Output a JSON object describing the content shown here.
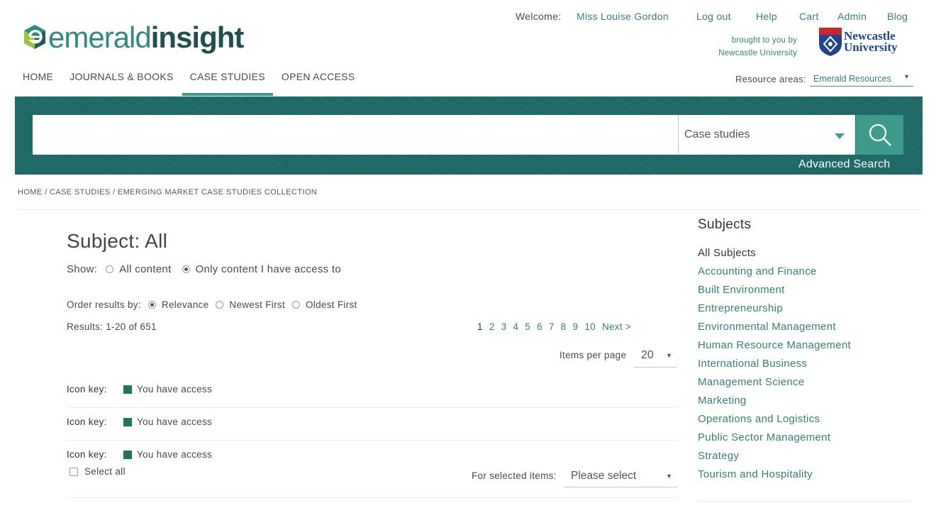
{
  "header": {
    "welcome_label": "Welcome:",
    "user_name": "Miss Louise Gordon",
    "links": [
      "Log out",
      "Help",
      "Cart",
      "Admin",
      "Blog"
    ],
    "logo": {
      "part1": "emerald",
      "part2": "insight"
    },
    "brought_by": [
      "brought to you by",
      "Newcastle University"
    ],
    "institution": [
      "Newcastle",
      "University"
    ],
    "resource_label": "Resource areas:",
    "resource_value": "Emerald Resources",
    "brand_color": "#1f6a66",
    "accent_color": "#3b9c8f"
  },
  "nav": {
    "items": [
      "HOME",
      "JOURNALS & BOOKS",
      "CASE STUDIES",
      "OPEN ACCESS"
    ],
    "active": "CASE STUDIES"
  },
  "search": {
    "query": "",
    "type": "Case studies",
    "advanced_label": "Advanced Search"
  },
  "breadcrumb": [
    "HOME",
    "CASE STUDIES",
    "EMERGING MARKET CASE STUDIES COLLECTION"
  ],
  "main": {
    "title": "Subject: All",
    "show_label": "Show:",
    "show_options": [
      "All content",
      "Only content I have access to"
    ],
    "show_selected": "Only content I have access to",
    "order_label": "Order results by:",
    "order_options": [
      "Relevance",
      "Newest First",
      "Oldest First"
    ],
    "order_selected": "Relevance",
    "results_text": "Results: 1-20 of 651",
    "pages": [
      "1",
      "2",
      "3",
      "4",
      "5",
      "6",
      "7",
      "8",
      "9",
      "10",
      "Next >"
    ],
    "current_page": "1",
    "items_per_page_label": "Items per page",
    "items_per_page": "20",
    "icon_key_rows": [
      {
        "label": "Icon key:",
        "value": "You have access"
      },
      {
        "label": "Icon key:",
        "value": "You have access"
      },
      {
        "label": "Icon key:",
        "value": "You have access"
      }
    ],
    "access_color": "#1f7a4a",
    "select_all_label": "Select all",
    "bulk_label": "For selected items:",
    "bulk_value": "Please select"
  },
  "sidebar": {
    "title": "Subjects",
    "items": [
      "All Subjects",
      "Accounting and Finance",
      "Built Environment",
      "Entrepreneurship",
      "Environmental Management",
      "Human Resource Management",
      "International Business",
      "Management Science",
      "Marketing",
      "Operations and Logistics",
      "Public Sector Management",
      "Strategy",
      "Tourism and Hospitality"
    ]
  }
}
